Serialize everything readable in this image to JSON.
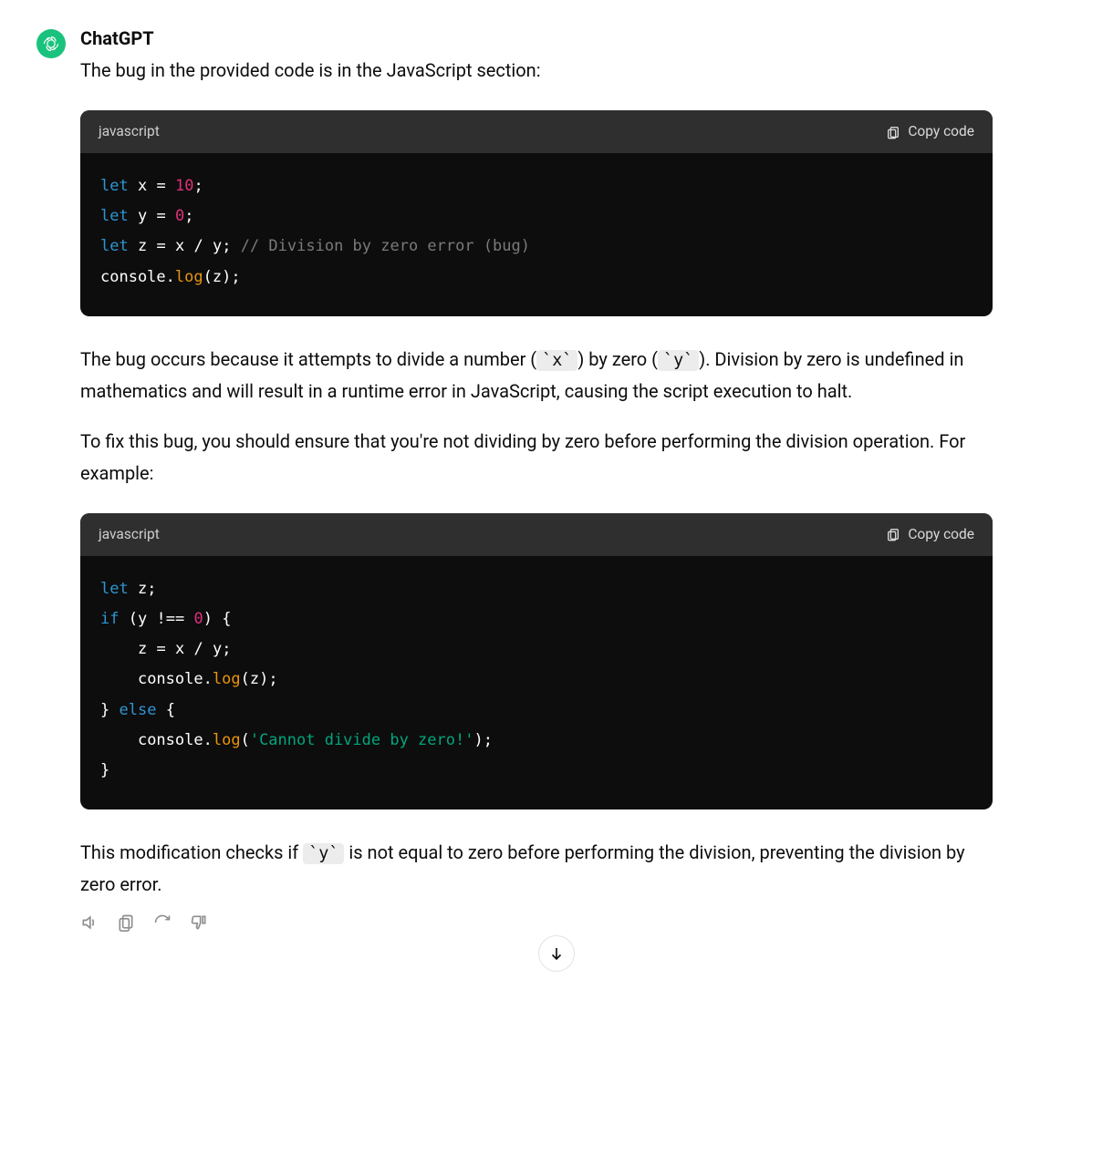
{
  "author": "ChatGPT",
  "intro": "The bug in the provided code is in the JavaScript section:",
  "code1": {
    "lang": "javascript",
    "copy_label": "Copy code",
    "tokens": {
      "let": "let",
      "x": "x",
      "y": "y",
      "z": "z",
      "eq": "=",
      "ten": "10",
      "zero": "0",
      "semi": ";",
      "slash": "/",
      "comment": "// Division by zero error (bug)",
      "console": "console",
      "dot": ".",
      "log": "log",
      "lp": "(",
      "rp": ")"
    }
  },
  "para1_a": "The bug occurs because it attempts to divide a number (",
  "para1_x": "`x`",
  "para1_b": ") by zero (",
  "para1_y": "`y`",
  "para1_c": "). Division by zero is undefined in mathematics and will result in a runtime error in JavaScript, causing the script execution to halt.",
  "para2": "To fix this bug, you should ensure that you're not dividing by zero before performing the division operation. For example:",
  "code2": {
    "lang": "javascript",
    "copy_label": "Copy code",
    "tokens": {
      "let": "let",
      "if": "if",
      "else": "else",
      "z": "z",
      "y": "y",
      "x": "x",
      "neq": "!==",
      "zero": "0",
      "lp": "(",
      "rp": ")",
      "lb": "{",
      "rb": "}",
      "eq": "=",
      "slash": "/",
      "semi": ";",
      "console": "console",
      "dot": ".",
      "log": "log",
      "str": "'Cannot divide by zero!'"
    }
  },
  "para3_a": "This modification checks if ",
  "para3_y": "`y`",
  "para3_b": " is not equal to zero before performing the division, preventing the division by zero error."
}
